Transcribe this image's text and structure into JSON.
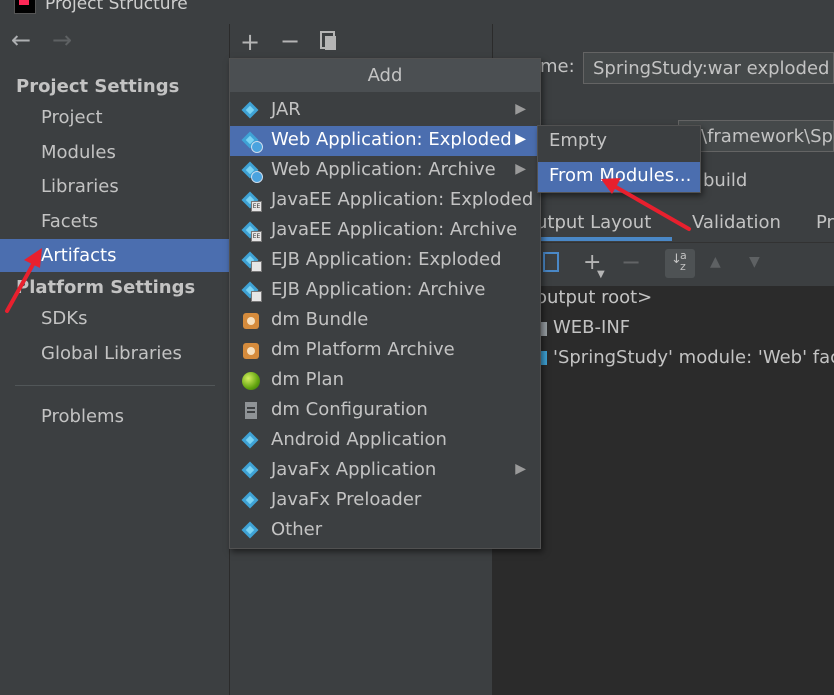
{
  "window": {
    "title": "Project Structure"
  },
  "nav": {
    "back_icon": "arrow-left-icon",
    "forward_icon": "arrow-right-icon"
  },
  "sidebar": {
    "project_settings_label": "Project Settings",
    "project_items": [
      "Project",
      "Modules",
      "Libraries",
      "Facets",
      "Artifacts"
    ],
    "selected_item": "Artifacts",
    "platform_settings_label": "Platform Settings",
    "platform_items": [
      "SDKs",
      "Global Libraries"
    ],
    "problems_label": "Problems"
  },
  "toolbar": {
    "add_icon": "plus-icon",
    "remove_icon": "minus-icon",
    "copy_icon": "copy-icon"
  },
  "add_menu": {
    "header": "Add",
    "items": [
      {
        "label": "JAR",
        "icon": "jar-artifact-icon",
        "submenu": true
      },
      {
        "label": "Web Application: Exploded",
        "icon": "web-exploded-icon",
        "submenu": true,
        "highlighted": true
      },
      {
        "label": "Web Application: Archive",
        "icon": "web-archive-icon",
        "submenu": true
      },
      {
        "label": "JavaEE Application: Exploded",
        "icon": "javaee-exploded-icon",
        "submenu": false
      },
      {
        "label": "JavaEE Application: Archive",
        "icon": "javaee-archive-icon",
        "submenu": false
      },
      {
        "label": "EJB Application: Exploded",
        "icon": "ejb-exploded-icon",
        "submenu": false
      },
      {
        "label": "EJB Application: Archive",
        "icon": "ejb-archive-icon",
        "submenu": false
      },
      {
        "label": "dm Bundle",
        "icon": "dm-bundle-icon",
        "submenu": false
      },
      {
        "label": "dm Platform Archive",
        "icon": "dm-platform-icon",
        "submenu": false
      },
      {
        "label": "dm Plan",
        "icon": "dm-plan-icon",
        "submenu": false
      },
      {
        "label": "dm Configuration",
        "icon": "dm-configuration-icon",
        "submenu": false
      },
      {
        "label": "Android Application",
        "icon": "android-artifact-icon",
        "submenu": false
      },
      {
        "label": "JavaFx Application",
        "icon": "javafx-artifact-icon",
        "submenu": true
      },
      {
        "label": "JavaFx Preloader",
        "icon": "javafx-preloader-icon",
        "submenu": false
      },
      {
        "label": "Other",
        "icon": "other-artifact-icon",
        "submenu": false
      }
    ]
  },
  "sub_menu": {
    "items": [
      "Empty",
      "From Modules..."
    ],
    "highlighted_index": 1
  },
  "details": {
    "name_label": "me:",
    "name_value": "SpringStudy:war exploded",
    "output_dir_value": "\\framework\\Spr",
    "build_label": "build",
    "tabs": [
      "utput Layout",
      "Validation",
      "Pr"
    ],
    "active_tab": "utput Layout",
    "tree": [
      "output root>",
      "WEB-INF",
      "'SpringStudy' module: 'Web' face"
    ]
  },
  "colors": {
    "selection": "#4b6eaf",
    "annotation": "#e8202e",
    "background": "#3c3f41"
  }
}
